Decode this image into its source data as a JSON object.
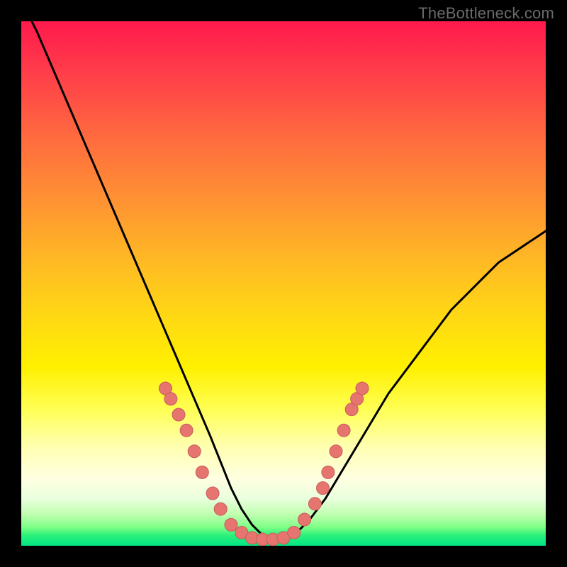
{
  "watermark": "TheBottleneck.com",
  "colors": {
    "background": "#000000",
    "curve": "#000000",
    "marker_fill": "#e6746f",
    "marker_stroke": "#c85c5c"
  },
  "chart_data": {
    "type": "line",
    "title": "",
    "xlabel": "",
    "ylabel": "",
    "xlim": [
      0,
      100
    ],
    "ylim": [
      0,
      100
    ],
    "series": [
      {
        "name": "bottleneck-curve",
        "x": [
          0,
          3,
          6,
          9,
          12,
          15,
          18,
          21,
          24,
          27,
          30,
          33,
          36,
          38,
          40,
          42,
          44,
          46,
          48,
          50,
          52,
          55,
          58,
          61,
          64,
          67,
          70,
          73,
          76,
          79,
          82,
          85,
          88,
          91,
          94,
          97,
          100
        ],
        "y": [
          104,
          98,
          91,
          84,
          77,
          70,
          63,
          56,
          49,
          42,
          35,
          28,
          21,
          16,
          11,
          7,
          4,
          2,
          1,
          1,
          2,
          5,
          9,
          14,
          19,
          24,
          29,
          33,
          37,
          41,
          45,
          48,
          51,
          54,
          56,
          58,
          60
        ]
      }
    ],
    "markers": {
      "name": "highlight-points",
      "points": [
        {
          "x": 27.5,
          "y": 30
        },
        {
          "x": 28.5,
          "y": 28
        },
        {
          "x": 30.0,
          "y": 25
        },
        {
          "x": 31.5,
          "y": 22
        },
        {
          "x": 33.0,
          "y": 18
        },
        {
          "x": 34.5,
          "y": 14
        },
        {
          "x": 36.5,
          "y": 10
        },
        {
          "x": 38.0,
          "y": 7
        },
        {
          "x": 40.0,
          "y": 4
        },
        {
          "x": 42.0,
          "y": 2.5
        },
        {
          "x": 44.0,
          "y": 1.5
        },
        {
          "x": 46.0,
          "y": 1.2
        },
        {
          "x": 48.0,
          "y": 1.2
        },
        {
          "x": 50.0,
          "y": 1.5
        },
        {
          "x": 52.0,
          "y": 2.5
        },
        {
          "x": 54.0,
          "y": 5
        },
        {
          "x": 56.0,
          "y": 8
        },
        {
          "x": 57.5,
          "y": 11
        },
        {
          "x": 58.5,
          "y": 14
        },
        {
          "x": 60.0,
          "y": 18
        },
        {
          "x": 61.5,
          "y": 22
        },
        {
          "x": 63.0,
          "y": 26
        },
        {
          "x": 64.0,
          "y": 28
        },
        {
          "x": 65.0,
          "y": 30
        }
      ]
    }
  }
}
